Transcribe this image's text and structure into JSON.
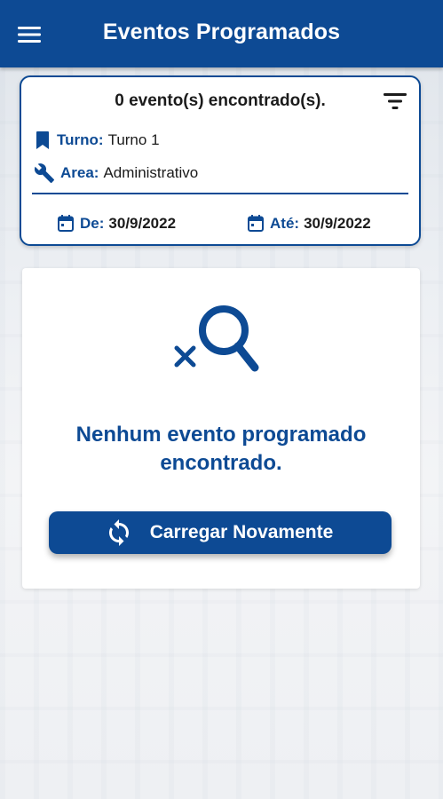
{
  "colors": {
    "primary": "#0d4a94",
    "card_background": "#ffffff",
    "text_dark": "#1b1b1b",
    "page_background": "#eceff3"
  },
  "appbar": {
    "title": "Eventos Programados",
    "menu_icon": "hamburger-menu-icon"
  },
  "filter_card": {
    "count_text": "0 evento(s) encontrado(s).",
    "filter_icon": "filter-icon",
    "turno": {
      "icon": "bookmark-icon",
      "label": "Turno:",
      "value": "Turno 1"
    },
    "area": {
      "icon": "wrench-icon",
      "label": "Area:",
      "value": "Administrativo"
    },
    "date_from": {
      "icon": "calendar-icon",
      "label": "De:",
      "value": "30/9/2022"
    },
    "date_to": {
      "icon": "calendar-icon",
      "label": "Até:",
      "value": "30/9/2022"
    }
  },
  "empty_state": {
    "icon": "search-off-icon",
    "message": "Nenhum evento programado encontrado.",
    "reload_button": {
      "icon": "refresh-icon",
      "label": "Carregar Novamente"
    }
  }
}
